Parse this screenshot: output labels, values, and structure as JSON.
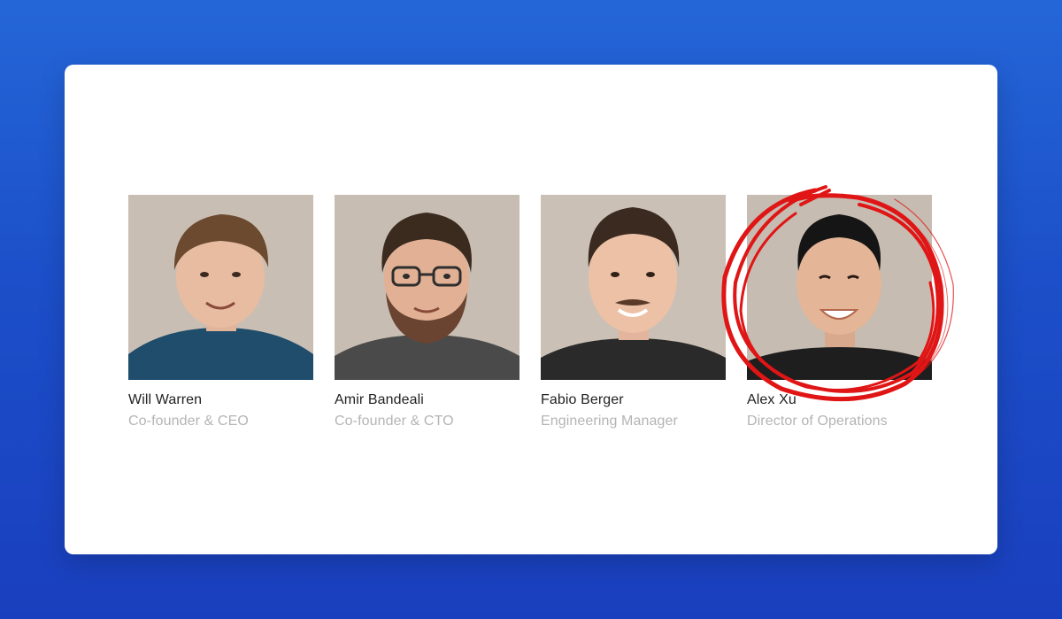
{
  "team": [
    {
      "name": "Will Warren",
      "role": "Co-founder & CEO",
      "shirt": "#1f4d6b",
      "hair": "#6b4a2f",
      "beard": false,
      "glasses": false,
      "mustache": false
    },
    {
      "name": "Amir Bandeali",
      "role": "Co-founder & CTO",
      "shirt": "#4a4a4a",
      "hair": "#3b2a1e",
      "beard": true,
      "glasses": true,
      "mustache": false
    },
    {
      "name": "Fabio Berger",
      "role": "Engineering Manager",
      "shirt": "#2a2a2a",
      "hair": "#3a2a20",
      "beard": false,
      "glasses": false,
      "mustache": true
    },
    {
      "name": "Alex Xu",
      "role": "Director of Operations",
      "shirt": "#1e1e1e",
      "hair": "#151515",
      "beard": false,
      "glasses": false,
      "mustache": false
    }
  ],
  "colors": {
    "background_top": "#2466d8",
    "background_bottom": "#1a3fbe",
    "card": "#ffffff",
    "name_text": "#222222",
    "role_text": "#b4b4b4",
    "highlight_scribble": "#e01515"
  },
  "highlight": {
    "target": "Alex Xu",
    "style": "red hand-drawn circle"
  }
}
